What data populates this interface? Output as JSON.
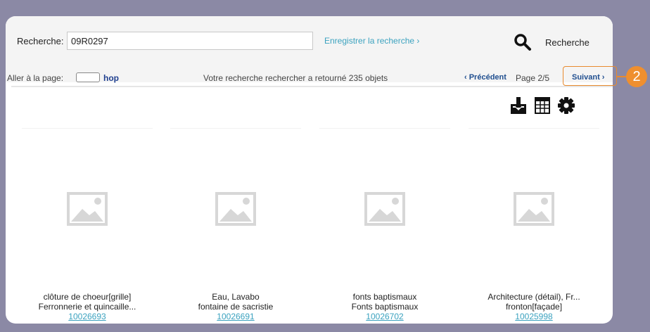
{
  "search": {
    "label": "Recherche:",
    "value": "09R0297",
    "save_link": "Enregistrer la recherche ›",
    "button_label": "Recherche"
  },
  "pager": {
    "goto_label": "Aller à la page:",
    "hop_label": "hop",
    "result_text": "Votre recherche rechercher a retourné 235 objets",
    "prev_label": "‹ Précédent",
    "page_text": "Page 2/5",
    "next_label": "Suivant ›"
  },
  "tools": [
    "download-icon",
    "table-view-icon",
    "settings-icon"
  ],
  "items": [
    {
      "line1": "clôture de choeur[grille]",
      "line2": "Ferronnerie et quincaille...",
      "id": "10026693"
    },
    {
      "line1": "Eau, Lavabo",
      "line2": "fontaine de sacristie",
      "id": "10026691"
    },
    {
      "line1": "fonts baptismaux",
      "line2": "Fonts baptismaux",
      "id": "10026702"
    },
    {
      "line1": "Architecture (détail), Fr...",
      "line2": "fronton[façade]",
      "id": "10025998"
    }
  ],
  "callout": {
    "number": "2",
    "color": "#ef8f2f"
  },
  "colors": {
    "link": "#3ba2bf",
    "nav": "#1f4e8f",
    "background": "#8b89a5"
  }
}
